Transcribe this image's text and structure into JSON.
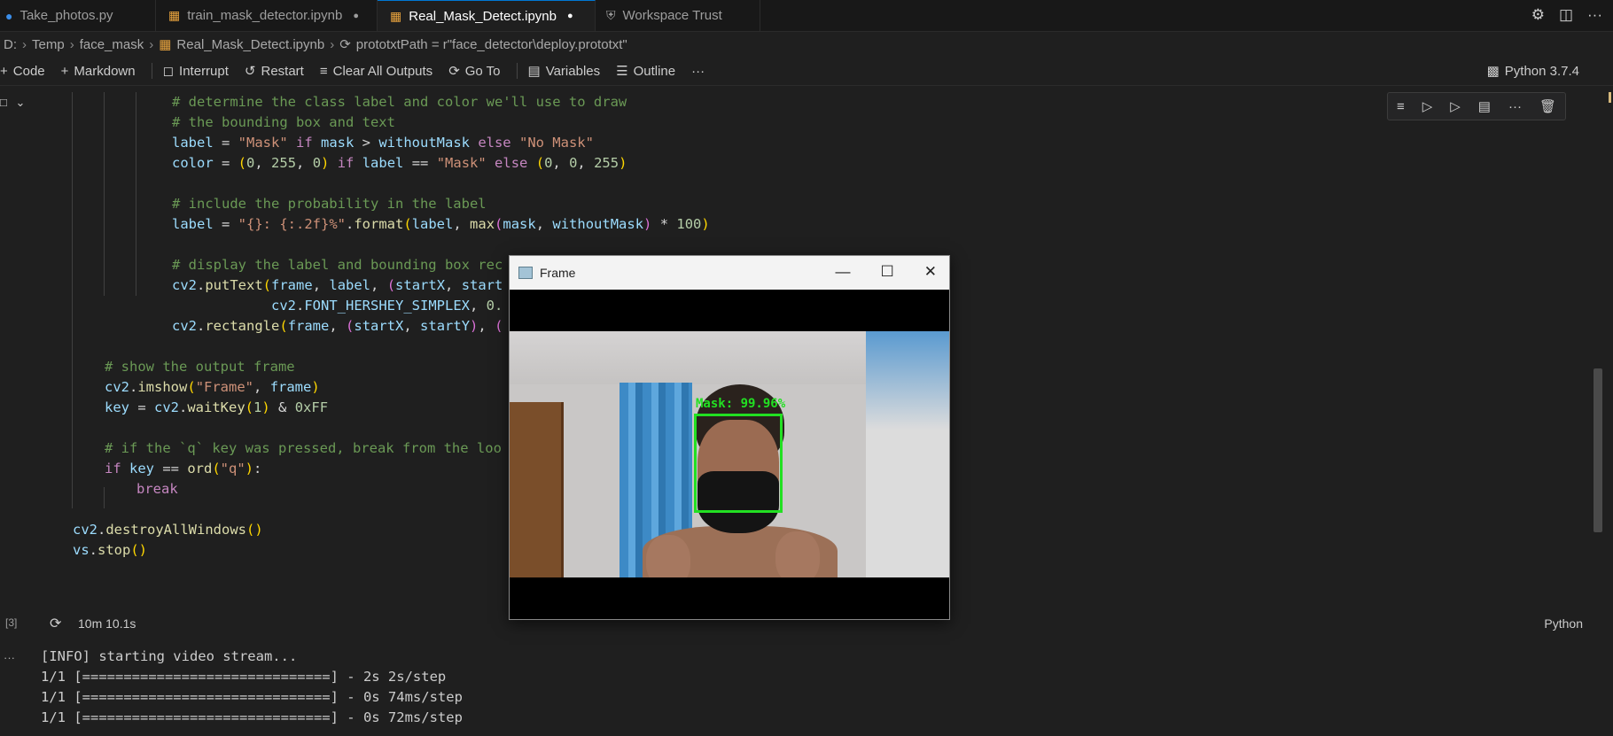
{
  "tabs": [
    {
      "label": "Take_photos.py",
      "icon": "python-icon",
      "dirty": false
    },
    {
      "label": "train_mask_detector.ipynb",
      "icon": "notebook-icon",
      "dirty": true
    },
    {
      "label": "Real_Mask_Detect.ipynb",
      "icon": "notebook-icon",
      "dirty": true,
      "active": true
    },
    {
      "label": "Workspace Trust",
      "icon": "shield-icon",
      "dirty": false
    }
  ],
  "breadcrumb": {
    "drive": "D:",
    "folder1": "Temp",
    "folder2": "face_mask",
    "file": "Real_Mask_Detect.ipynb",
    "symbol": "prototxtPath = r\"face_detector\\deploy.prototxt\""
  },
  "toolbar": {
    "code": "Code",
    "markdown": "Markdown",
    "interrupt": "Interrupt",
    "restart": "Restart",
    "clear_outputs": "Clear All Outputs",
    "goto": "Go To",
    "variables": "Variables",
    "outline": "Outline",
    "more": "···",
    "kernel": "Python 3.7.4"
  },
  "cell": {
    "exec_count": "[3]",
    "duration": "10m 10.1s",
    "language": "Python",
    "code_lines": [
      "# determine the class label and color we'll use to draw",
      "# the bounding box and text",
      "label = \"Mask\" if mask > withoutMask else \"No Mask\"",
      "color = (0, 255, 0) if label == \"Mask\" else (0, 0, 255)",
      "",
      "# include the probability in the label",
      "label = \"{}: {:.2f}%\".format(label, max(mask, withoutMask) * 100)",
      "",
      "# display the label and bounding box rec",
      "cv2.putText(frame, label, (startX, start",
      "cv2.FONT_HERSHEY_SIMPLEX, 0.",
      "cv2.rectangle(frame, (startX, startY), (",
      "",
      "# show the output frame",
      "cv2.imshow(\"Frame\", frame)",
      "key = cv2.waitKey(1) & 0xFF",
      "",
      "# if the `q` key was pressed, break from the loo",
      "if key == ord(\"q\"):",
      "break",
      "",
      "cv2.destroyAllWindows()",
      "vs.stop()"
    ]
  },
  "output_lines": [
    "[INFO] starting video stream...",
    "1/1 [==============================] - 2s 2s/step",
    "1/1 [==============================] - 0s 74ms/step",
    "1/1 [==============================] - 0s 72ms/step"
  ],
  "frame_window": {
    "title": "Frame",
    "detection_label": "Mask: 99.96%",
    "box_color": "#22e022"
  },
  "colors": {
    "accent": "#0078d4",
    "background": "#1f1f1f"
  }
}
